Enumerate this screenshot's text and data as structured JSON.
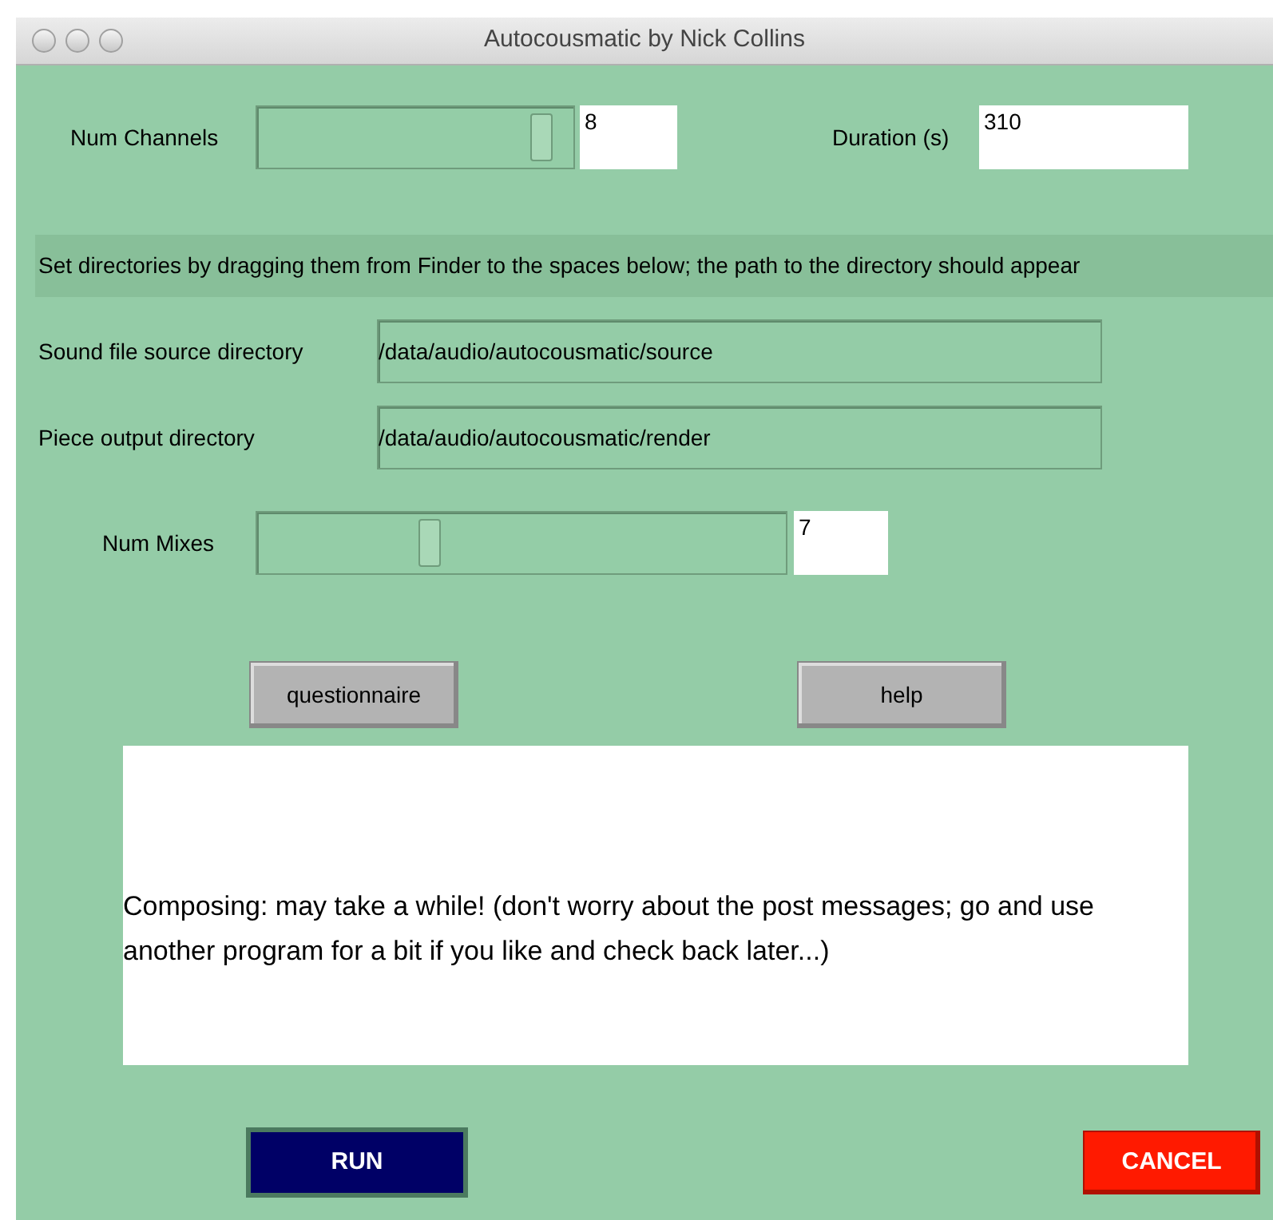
{
  "window": {
    "title": "Autocousmatic by Nick Collins"
  },
  "num_channels": {
    "label": "Num Channels",
    "level": 0.93,
    "value": "8"
  },
  "duration": {
    "label": "Duration (s)",
    "value": "310"
  },
  "instructions": "Set directories by dragging them from Finder to the spaces below; the path to the directory should appear",
  "directories": [
    {
      "label": "Sound file source directory",
      "value": "/data/audio/autocousmatic/source"
    },
    {
      "label": "Piece output directory",
      "value": "/data/audio/autocousmatic/render"
    }
  ],
  "num_mixes": {
    "label": "Num Mixes",
    "level": 0.32,
    "value": "7"
  },
  "buttons": [
    "questionnaire",
    "help"
  ],
  "message": "Composing: may take a while! (don't worry about the post messages; go and use another program for a bit if you like and check back later...)",
  "run_button": "RUN",
  "cancel_button": "CANCEL"
}
